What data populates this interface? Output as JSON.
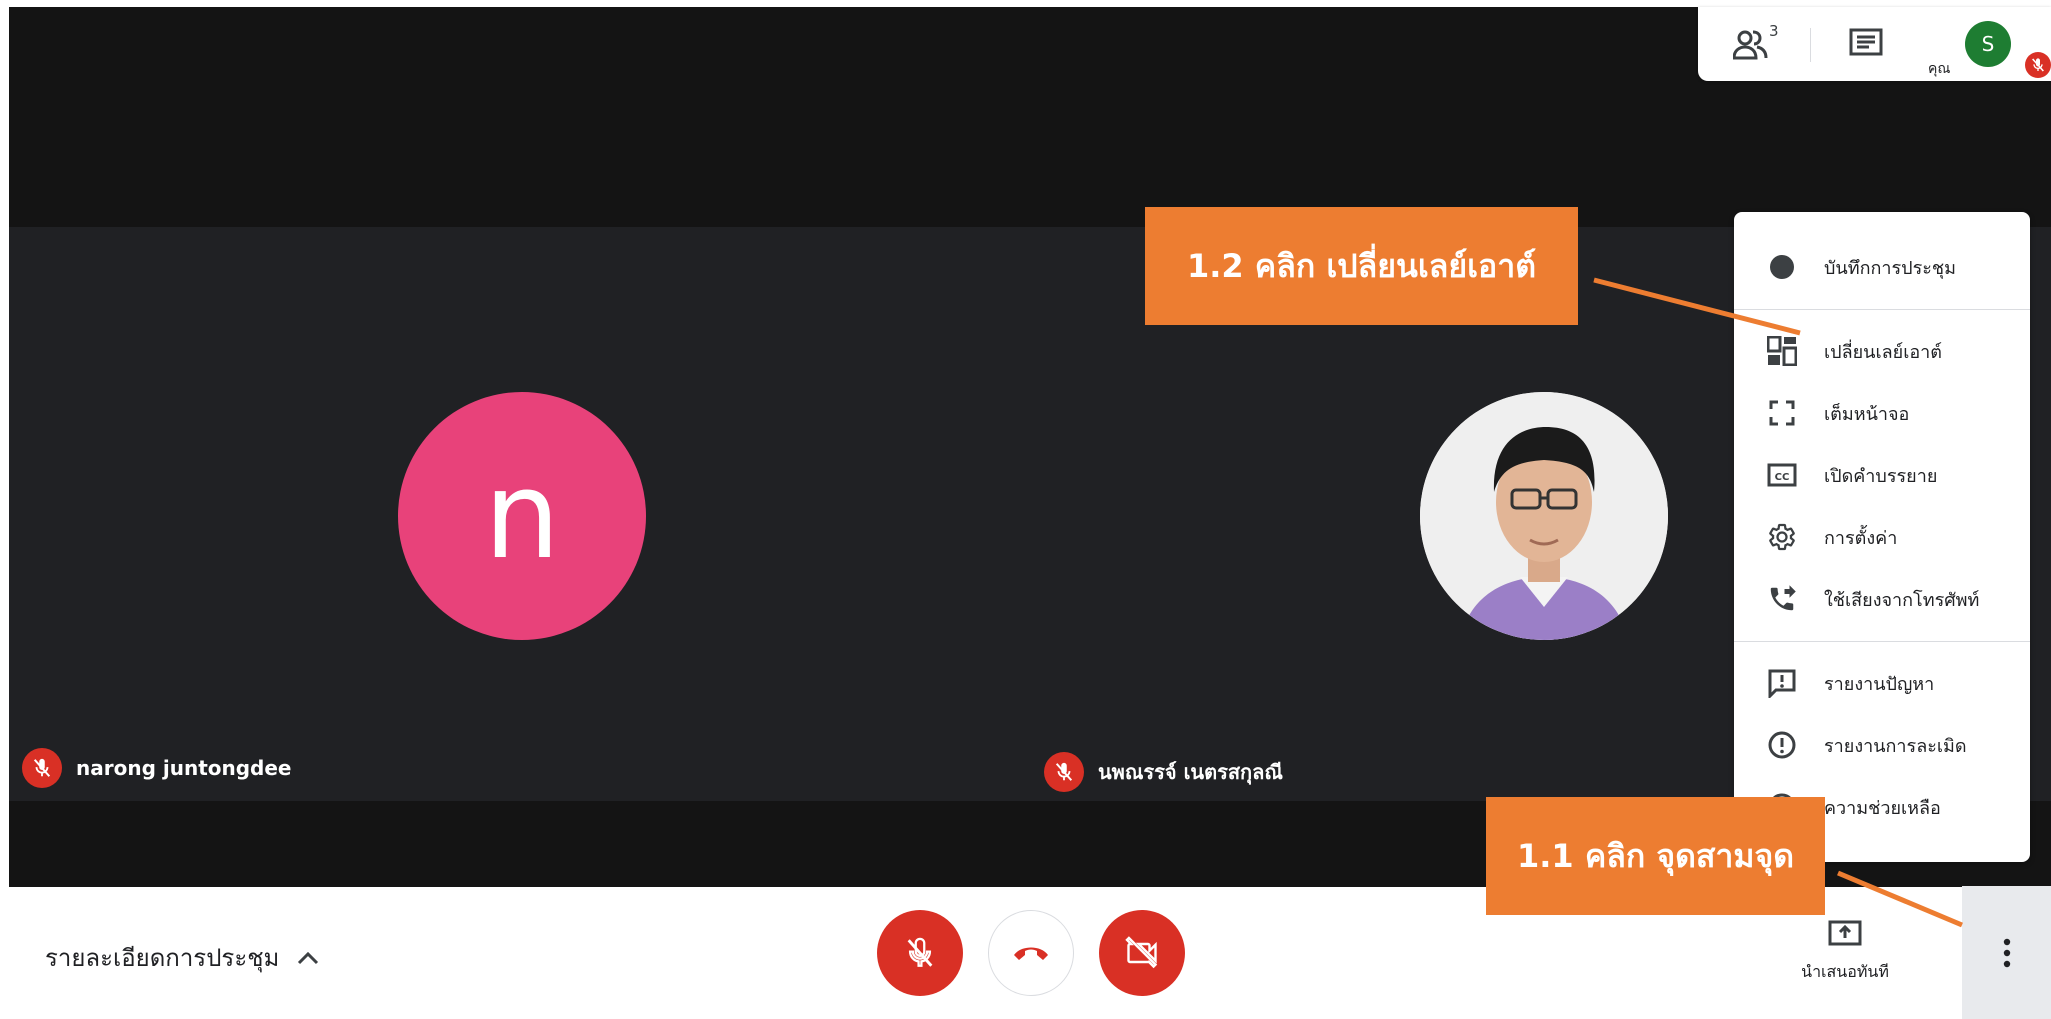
{
  "participants": {
    "tile_left": {
      "name": "narong juntongdee",
      "initial": "n",
      "avatar_color": "#e8427a"
    },
    "tile_right": {
      "name": "นพณรรจ์ เนตรสกุลณี"
    }
  },
  "topbar": {
    "participant_count": "3",
    "you_label": "คุณ",
    "user_initial": "S",
    "user_color": "#1e7d32"
  },
  "menu": {
    "items": [
      {
        "label": "บันทึกการประชุม",
        "icon": "record-icon"
      },
      {
        "label": "เปลี่ยนเลย์เอาต์",
        "icon": "layout-icon"
      },
      {
        "label": "เต็มหน้าจอ",
        "icon": "fullscreen-icon"
      },
      {
        "label": "เปิดคำบรรยาย",
        "icon": "captions-icon"
      },
      {
        "label": "การตั้งค่า",
        "icon": "gear-icon"
      },
      {
        "label": "ใช้เสียงจากโทรศัพท์",
        "icon": "phone-forward-icon"
      },
      {
        "label": "รายงานปัญหา",
        "icon": "feedback-icon"
      },
      {
        "label": "รายงานการละเมิด",
        "icon": "report-icon"
      },
      {
        "label": "ความช่วยเหลือ",
        "icon": "help-icon"
      }
    ]
  },
  "bottombar": {
    "details_label": "รายละเอียดการประชุม",
    "present_label": "นำเสนอทันที"
  },
  "annotations": {
    "step_layout": "1.2 คลิก เปลี่ยนเลย์เอาต์",
    "step_dots": "1.1 คลิก จุดสามจุด",
    "color": "#ed7d31"
  },
  "colors": {
    "danger": "#d93025",
    "dark_bg": "#141414",
    "tile_bg": "#202124"
  }
}
